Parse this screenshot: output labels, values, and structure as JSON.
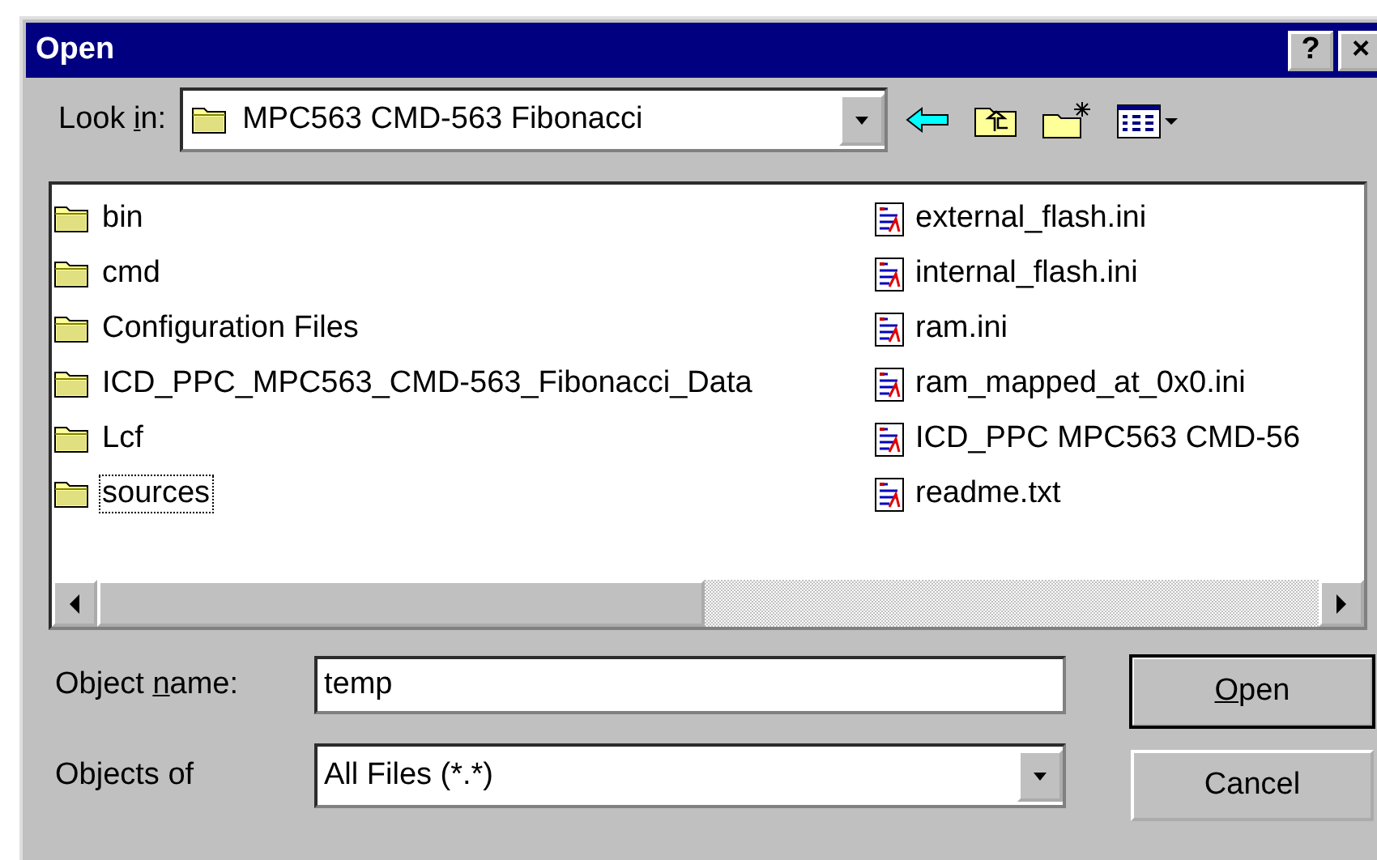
{
  "window": {
    "title": "Open",
    "buttons": [
      "?",
      "×"
    ]
  },
  "look_in": {
    "label": {
      "before": "Look ",
      "key": "i",
      "after": "n:"
    },
    "value": "MPC563 CMD-563 Fibonacci"
  },
  "files": {
    "columns": [
      [
        {
          "name": "bin",
          "kind": "folder",
          "focused": false
        },
        {
          "name": "cmd",
          "kind": "folder",
          "focused": false
        },
        {
          "name": "Configuration Files",
          "kind": "folder",
          "focused": false
        },
        {
          "name": "ICD_PPC_MPC563_CMD-563_Fibonacci_Data",
          "kind": "folder",
          "focused": false
        },
        {
          "name": "Lcf",
          "kind": "folder",
          "focused": false
        },
        {
          "name": "sources",
          "kind": "folder",
          "focused": true
        }
      ],
      [
        {
          "name": "external_flash.ini",
          "kind": "file",
          "focused": false
        },
        {
          "name": "internal_flash.ini",
          "kind": "file",
          "focused": false
        },
        {
          "name": "ram.ini",
          "kind": "file",
          "focused": false
        },
        {
          "name": "ram_mapped_at_0x0.ini",
          "kind": "file",
          "focused": false
        },
        {
          "name": "ICD_PPC MPC563 CMD-56",
          "kind": "file",
          "focused": false
        },
        {
          "name": "readme.txt",
          "kind": "file",
          "focused": false
        }
      ]
    ]
  },
  "object_name": {
    "label": {
      "before": "Object ",
      "key": "n",
      "after": "ame:"
    },
    "value": "temp"
  },
  "objects_of": {
    "label": {
      "before": "Objects of"
    },
    "value": "All Files (*.*)"
  },
  "buttons": [
    {
      "label": {
        "key": "O",
        "after": "pen"
      },
      "default": true
    },
    {
      "label": {
        "before": "Cancel"
      },
      "default": false
    }
  ]
}
